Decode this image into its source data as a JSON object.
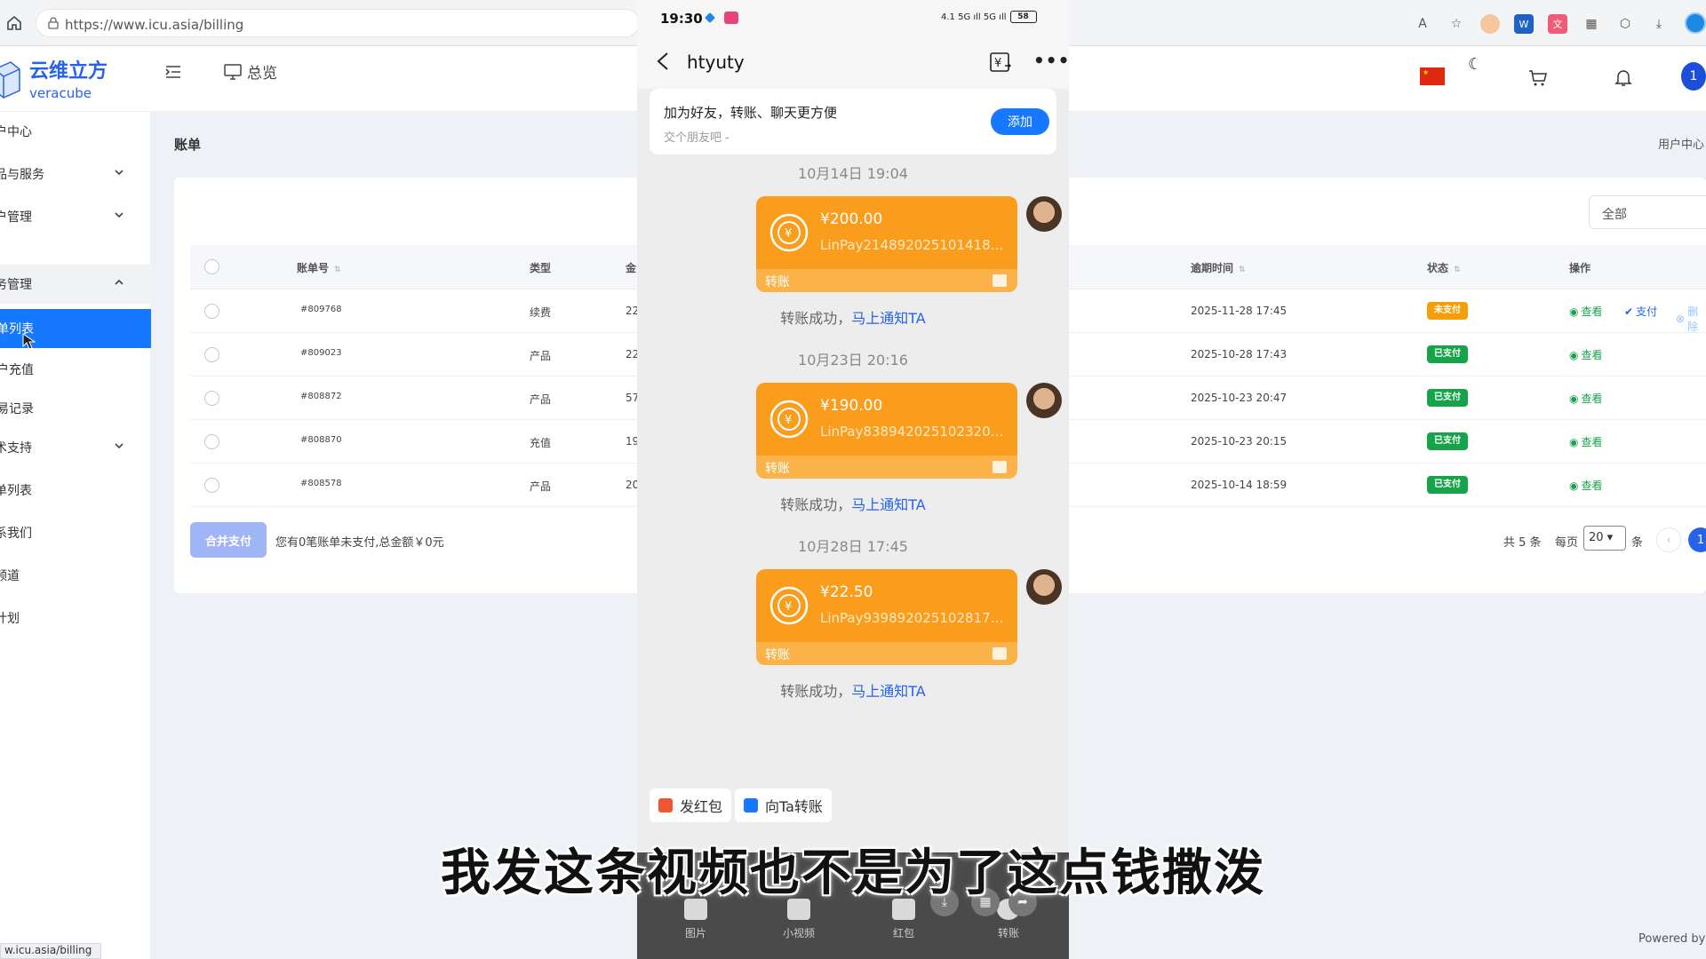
{
  "browser": {
    "url": "https://www.icu.asia/billing",
    "status_url": "w.icu.asia/billing"
  },
  "header": {
    "logo_title": "云维立方",
    "logo_sub": "veracube",
    "overview_label": "总览",
    "avatar_label": "1"
  },
  "sidebar": {
    "items": [
      {
        "label": "户中心"
      },
      {
        "label": "品与服务"
      },
      {
        "label": "户管理"
      },
      {
        "label": "务管理"
      },
      {
        "label": "单列表"
      },
      {
        "label": "户充值"
      },
      {
        "label": "易记录"
      },
      {
        "label": "术支持"
      },
      {
        "label": "单列表"
      },
      {
        "label": "系我们"
      },
      {
        "label": "频道"
      },
      {
        "label": "计划"
      }
    ]
  },
  "page": {
    "title": "账单",
    "user_center": "用户中心",
    "filter_value": "全部"
  },
  "table": {
    "headers": {
      "bill_no": "账单号",
      "type": "类型",
      "amount": "金",
      "due": "逾期时间",
      "status": "状态",
      "ops": "操作"
    },
    "rows": [
      {
        "bill_no": "#809768",
        "type": "续费",
        "amount": "22",
        "due": "2025-11-28 17:45",
        "status": "未支付",
        "status_kind": "unpaid"
      },
      {
        "bill_no": "#809023",
        "type": "产品",
        "amount": "22",
        "due": "2025-10-28 17:43",
        "status": "已支付",
        "status_kind": "paid"
      },
      {
        "bill_no": "#808872",
        "type": "产品",
        "amount": "57",
        "due": "2025-10-23 20:47",
        "status": "已支付",
        "status_kind": "paid"
      },
      {
        "bill_no": "#808870",
        "type": "充值",
        "amount": "19",
        "due": "2025-10-23 20:15",
        "status": "已支付",
        "status_kind": "paid"
      },
      {
        "bill_no": "#808578",
        "type": "产品",
        "amount": "20",
        "due": "2025-10-14 18:59",
        "status": "已支付",
        "status_kind": "paid"
      }
    ],
    "op_view": "查看",
    "op_pay": "支付",
    "op_delete": "删除"
  },
  "footer": {
    "merge_pay": "合并支付",
    "unpaid_summary": "您有0笔账单未支付,总金额￥0元",
    "total": "共 5 条",
    "per_page_label": "每页",
    "per_page_value": "20",
    "per_page_unit": "条",
    "prev": "‹",
    "current_page": "1",
    "powered": "Powered by"
  },
  "phone": {
    "time": "19:30",
    "battery": "58",
    "signal": "4.1 5G ıll 5G ıll",
    "chat_title": "htyuty",
    "friend_title": "加为好友，转账、聊天更方便",
    "friend_sub": "交个朋友吧 -",
    "add_label": "添加",
    "messages": [
      {
        "time": "10月14日 19:04",
        "amount": "¥200.00",
        "ref": "LinPay2148920251014185...",
        "type": "转账"
      },
      {
        "time": "10月23日 20:16",
        "amount": "¥190.00",
        "ref": "LinPay8389420251023201...",
        "type": "转账"
      },
      {
        "time": "10月28日 17:45",
        "amount": "¥22.50",
        "ref": "LinPay9398920251028174...",
        "type": "转账"
      }
    ],
    "success_text": "转账成功，",
    "notify_link": "马上通知TA",
    "quick_red_packet": "发红包",
    "quick_transfer": "向Ta转账",
    "tools": [
      {
        "label": "图片"
      },
      {
        "label": "小视频"
      },
      {
        "label": "红包"
      },
      {
        "label": "转账"
      }
    ]
  },
  "subtitle": "我发这条视频也不是为了这点钱撒泼",
  "colors": {
    "primary": "#1677ff",
    "paid": "#16a34a",
    "unpaid": "#f59e0b",
    "transfer_card": "#fa9d1c"
  }
}
